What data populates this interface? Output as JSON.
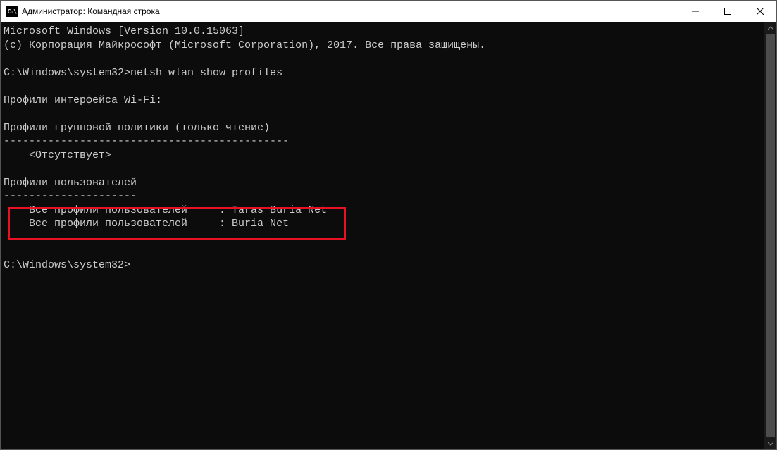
{
  "window": {
    "title": "Администратор: Командная строка"
  },
  "terminal": {
    "line1": "Microsoft Windows [Version 10.0.15063]",
    "line2": "(c) Корпорация Майкрософт (Microsoft Corporation), 2017. Все права защищены.",
    "blank1": "",
    "prompt1": "C:\\Windows\\system32>netsh wlan show profiles",
    "blank2": "",
    "header1": "Профили интерфейса Wi-Fi:",
    "blank3": "",
    "header2": "Профили групповой политики (только чтение)",
    "sep1": "---------------------------------------------",
    "none": "    <Отсутствует>",
    "blank4": "",
    "header3": "Профили пользователей",
    "sep2": "---------------------",
    "profile1": "    Все профили пользователей     : Taras Buria Net",
    "profile2": "    Все профили пользователей     : Buria Net",
    "blank5": "",
    "blank6": "",
    "prompt2": "C:\\Windows\\system32>"
  }
}
